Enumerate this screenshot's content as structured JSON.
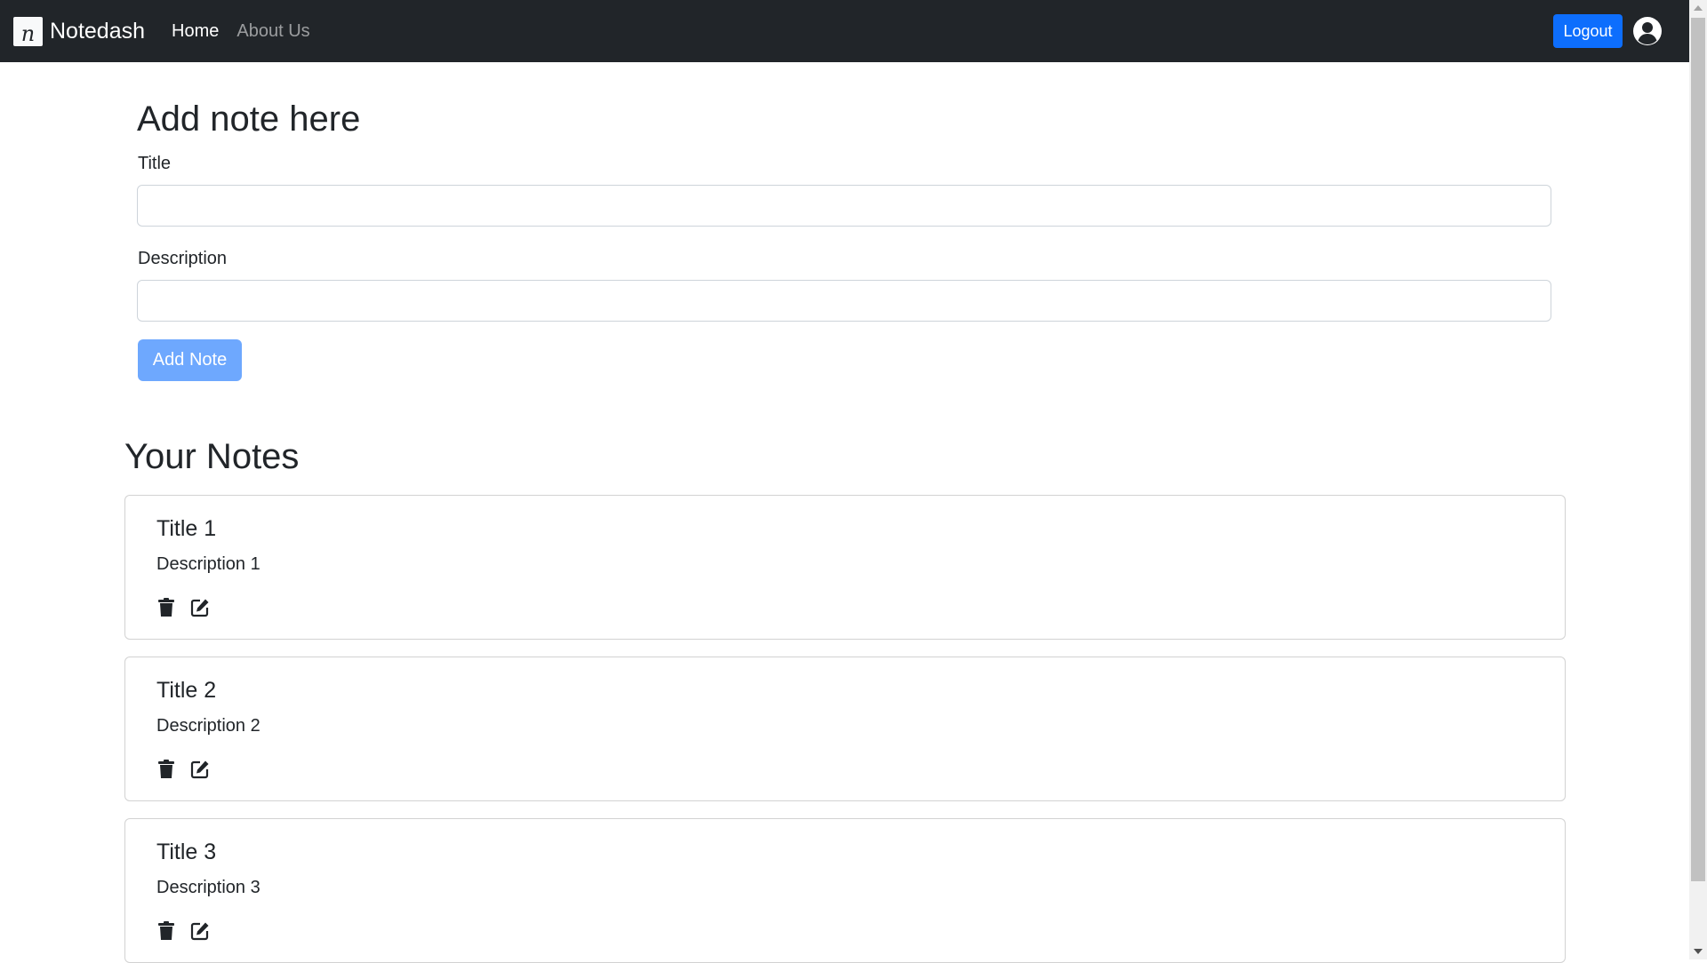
{
  "navbar": {
    "brand_logo_letter": "n",
    "brand_name": "Notedash",
    "links": [
      {
        "label": "Home",
        "active": true
      },
      {
        "label": "About Us",
        "active": false
      }
    ],
    "logout_label": "Logout",
    "user_icon": "user-circle-icon"
  },
  "add_note": {
    "heading": "Add note here",
    "title_label": "Title",
    "title_value": "",
    "description_label": "Description",
    "description_value": "",
    "submit_label": "Add Note"
  },
  "notes_section": {
    "heading": "Your Notes",
    "notes": [
      {
        "title": "Title 1",
        "description": "Description 1"
      },
      {
        "title": "Title 2",
        "description": "Description 2"
      },
      {
        "title": "Title 3",
        "description": "Description 3"
      }
    ],
    "action_icons": [
      "trash-icon",
      "edit-icon"
    ]
  },
  "colors": {
    "navbar_bg": "#212529",
    "primary": "#0d6efd",
    "primary_disabled": "#6ea8fe"
  }
}
